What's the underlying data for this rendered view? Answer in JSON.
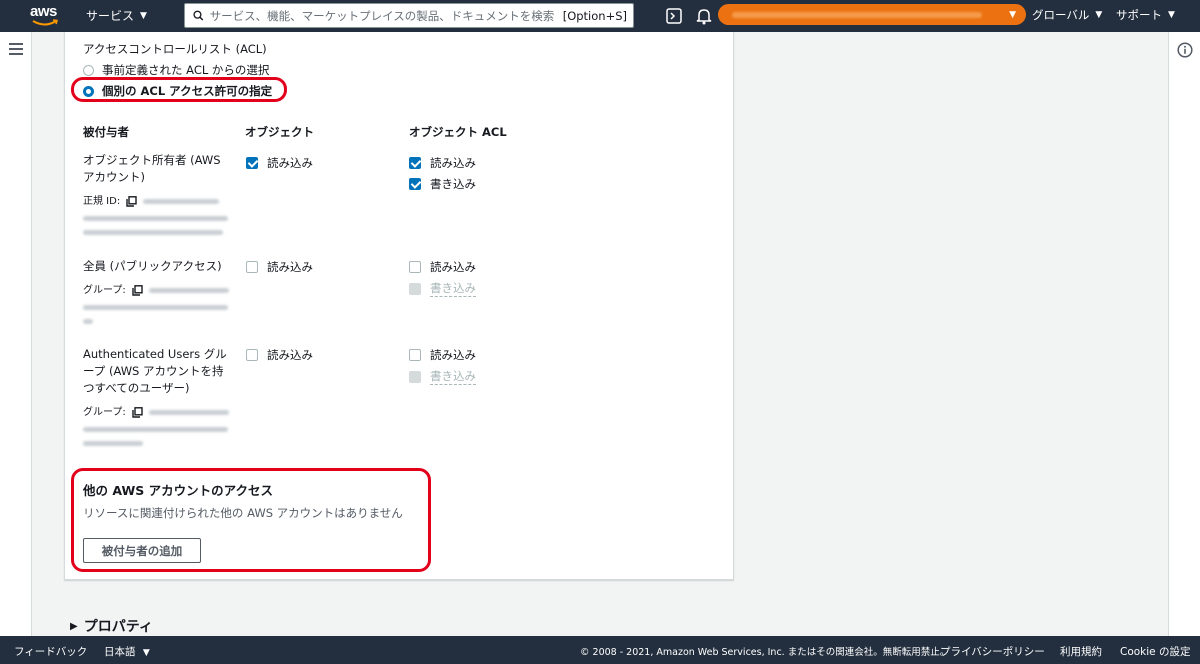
{
  "topnav": {
    "logo": "aws",
    "services_label": "サービス",
    "search_placeholder": "サービス、機能、マーケットプレイスの製品、ドキュメントを検索",
    "search_shortcut": "[Option+S]",
    "region_label": "グローバル",
    "support_label": "サポート",
    "accent_color": "#ec7211"
  },
  "acl": {
    "section_title": "アクセスコントロールリスト (ACL)",
    "option_predefined": "事前定義された ACL からの選択",
    "option_individual": "個別の ACL アクセス許可の指定",
    "selected": "option_individual"
  },
  "grants": {
    "col_grantee": "被付与者",
    "col_object": "オブジェクト",
    "col_object_acl": "オブジェクト ACL",
    "read": "読み込み",
    "write": "書き込み",
    "rows": [
      {
        "name": "オブジェクト所有者 (AWS アカウント)",
        "id_label": "正規 ID:",
        "object_read": true,
        "acl_read": true,
        "acl_write": true
      },
      {
        "name": "全員 (パブリックアクセス)",
        "id_label": "グループ:",
        "object_read": false,
        "acl_read": false,
        "acl_write_disabled": true
      },
      {
        "name": "Authenticated Users グループ (AWS アカウントを持つすべてのユーザー)",
        "id_label": "グループ:",
        "object_read": false,
        "acl_read": false,
        "acl_write_disabled": true
      }
    ]
  },
  "other_accounts": {
    "title": "他の AWS アカウントのアクセス",
    "description": "リソースに関連付けられた他の AWS アカウントはありません",
    "add_button": "被付与者の追加"
  },
  "properties_label": "プロパティ",
  "footer": {
    "feedback": "フィードバック",
    "language": "日本語",
    "copyright": "© 2008 - 2021, Amazon Web Services, Inc. またはその関連会社。無断転用禁止。",
    "privacy": "プライバシーポリシー",
    "terms": "利用規約",
    "cookie": "Cookie の設定"
  },
  "highlight_color": "#e3001b"
}
